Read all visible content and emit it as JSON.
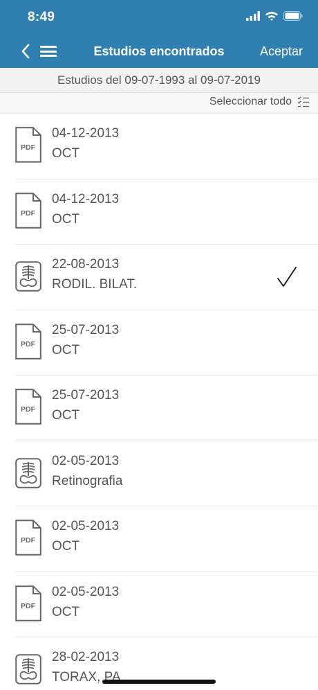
{
  "status_bar": {
    "time": "8:49"
  },
  "nav": {
    "title": "Estudios encontrados",
    "accept_label": "Aceptar"
  },
  "range": {
    "text": "Estudios del 09-07-1993 al 09-07-2019"
  },
  "select_all": {
    "label": "Seleccionar todo"
  },
  "icons": {
    "pdf_text": "PDF"
  },
  "colors": {
    "header": "#2f7fb1",
    "text": "#555555",
    "separator": "#e6e6e6"
  },
  "studies": [
    {
      "date": "04-12-2013",
      "type": "OCT",
      "icon": "pdf-icon",
      "selected": false
    },
    {
      "date": "04-12-2013",
      "type": "OCT",
      "icon": "pdf-icon",
      "selected": false
    },
    {
      "date": "22-08-2013",
      "type": "RODIL. BILAT.",
      "icon": "xray-icon",
      "selected": true
    },
    {
      "date": "25-07-2013",
      "type": "OCT",
      "icon": "pdf-icon",
      "selected": false
    },
    {
      "date": "25-07-2013",
      "type": "OCT",
      "icon": "pdf-icon",
      "selected": false
    },
    {
      "date": "02-05-2013",
      "type": "Retinografia",
      "icon": "xray-icon",
      "selected": false
    },
    {
      "date": "02-05-2013",
      "type": "OCT",
      "icon": "pdf-icon",
      "selected": false
    },
    {
      "date": "02-05-2013",
      "type": "OCT",
      "icon": "pdf-icon",
      "selected": false
    },
    {
      "date": "28-02-2013",
      "type": "TORAX, PA",
      "icon": "xray-icon",
      "selected": false
    }
  ]
}
